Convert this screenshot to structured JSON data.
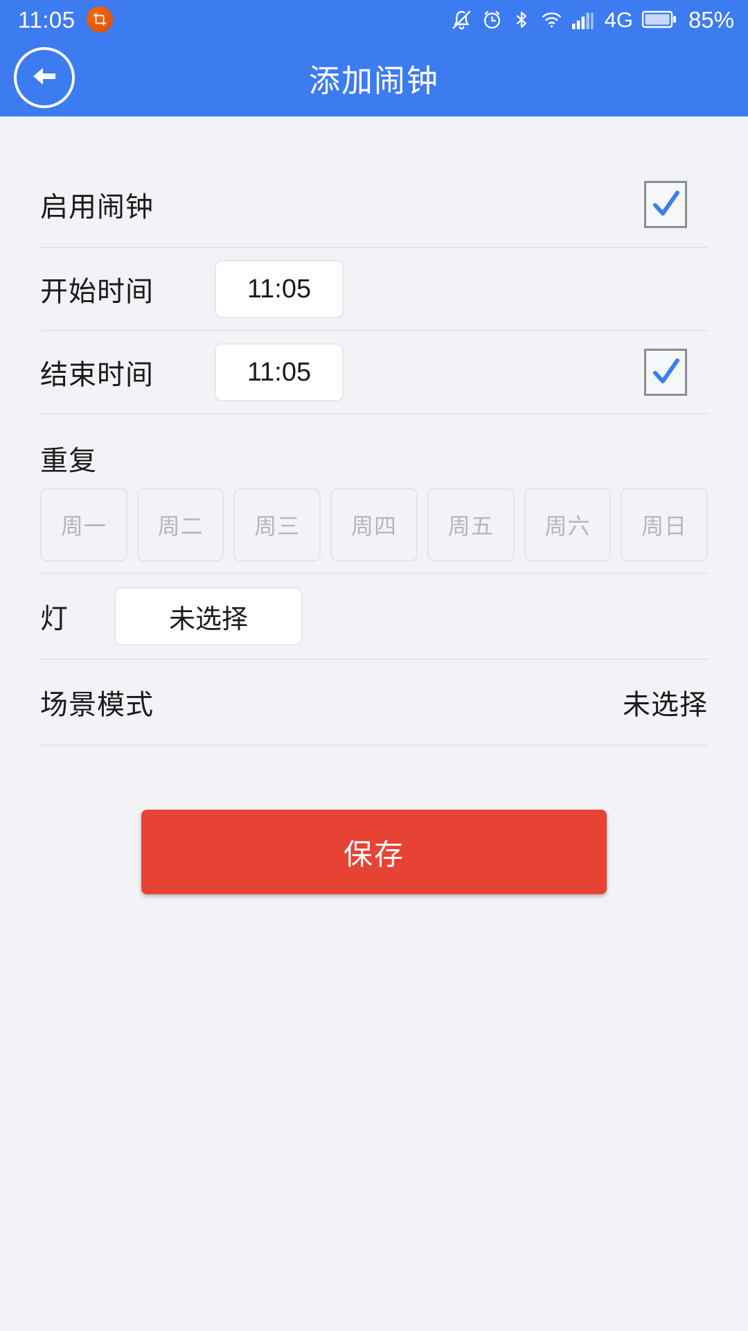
{
  "statusbar": {
    "time": "11:05",
    "badge_icon": "screenshot-crop-icon",
    "icons": [
      "bell-off-icon",
      "alarm-clock-icon",
      "bluetooth-icon",
      "wifi-icon",
      "signal-bars-icon"
    ],
    "network": "4G",
    "battery_percent": "85%",
    "bg_color": "#3d7bf0"
  },
  "header": {
    "title": "添加闹钟",
    "back_icon": "back-arrow-icon",
    "bg_color": "#3d7bf0"
  },
  "form": {
    "enable": {
      "label": "启用闹钟",
      "checked": true
    },
    "start_time": {
      "label": "开始时间",
      "value": "11:05"
    },
    "end_time": {
      "label": "结束时间",
      "value": "11:05",
      "checked": true
    },
    "repeat": {
      "label": "重复",
      "days": [
        {
          "label": "周一",
          "selected": false
        },
        {
          "label": "周二",
          "selected": false
        },
        {
          "label": "周三",
          "selected": false
        },
        {
          "label": "周四",
          "selected": false
        },
        {
          "label": "周五",
          "selected": false
        },
        {
          "label": "周六",
          "selected": false
        },
        {
          "label": "周日",
          "selected": false
        }
      ]
    },
    "light": {
      "label": "灯",
      "value": "未选择"
    },
    "scene_mode": {
      "label": "场景模式",
      "value": "未选择"
    }
  },
  "save": {
    "label": "保存",
    "color": "#e74335"
  },
  "colors": {
    "accent_blue": "#3d7bf0",
    "check_blue": "#3b7ff0",
    "page_bg": "#f2f3f7",
    "divider": "#e3e4e8"
  }
}
